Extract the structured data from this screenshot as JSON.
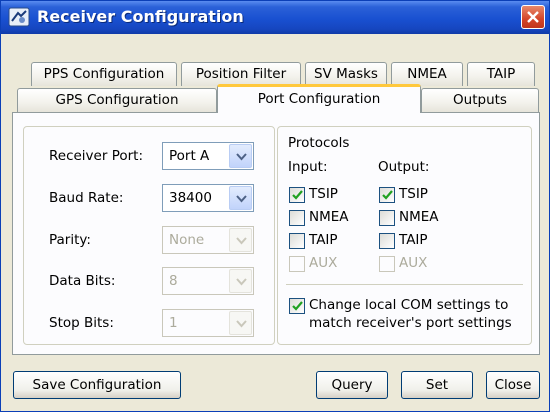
{
  "window": {
    "title": "Receiver Configuration"
  },
  "tabs": {
    "row1": [
      "PPS Configuration",
      "Position Filter",
      "SV Masks",
      "NMEA",
      "TAIP"
    ],
    "row2": [
      "GPS Configuration",
      "Port Configuration",
      "Outputs"
    ],
    "active": "Port Configuration"
  },
  "port": {
    "receiver_port_label": "Receiver Port:",
    "receiver_port_value": "Port A",
    "baud_rate_label": "Baud Rate:",
    "baud_rate_value": "38400",
    "parity_label": "Parity:",
    "parity_value": "None",
    "data_bits_label": "Data Bits:",
    "data_bits_value": "8",
    "stop_bits_label": "Stop Bits:",
    "stop_bits_value": "1"
  },
  "protocols": {
    "title": "Protocols",
    "input_header": "Input:",
    "output_header": "Output:",
    "input": [
      {
        "label": "TSIP",
        "checked": true,
        "enabled": true
      },
      {
        "label": "NMEA",
        "checked": false,
        "enabled": true
      },
      {
        "label": "TAIP",
        "checked": false,
        "enabled": true
      },
      {
        "label": "AUX",
        "checked": false,
        "enabled": false
      }
    ],
    "output": [
      {
        "label": "TSIP",
        "checked": true,
        "enabled": true
      },
      {
        "label": "NMEA",
        "checked": false,
        "enabled": true
      },
      {
        "label": "TAIP",
        "checked": false,
        "enabled": true
      },
      {
        "label": "AUX",
        "checked": false,
        "enabled": false
      }
    ],
    "change_com_line1": "Change local COM settings to",
    "change_com_line2": "match receiver's port settings",
    "change_com_checked": true
  },
  "buttons": {
    "save": "Save Configuration",
    "query": "Query",
    "set": "Set",
    "close": "Close"
  },
  "colors": {
    "titlebar": "#1950d1",
    "active_tab_accent": "#ffc83c",
    "check_green": "#21a121"
  }
}
